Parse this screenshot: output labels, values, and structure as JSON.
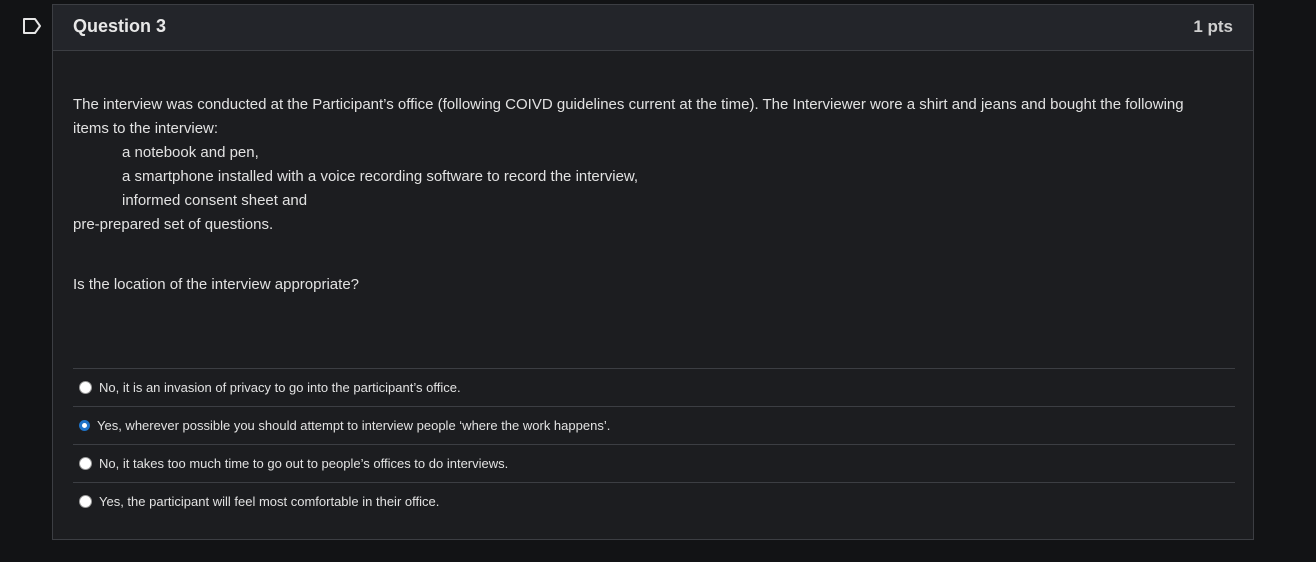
{
  "question": {
    "title": "Question 3",
    "points": "1 pts",
    "flag_icon": "bookmark-flag-icon",
    "intro": "The interview was conducted at the Participant’s office (following  COIVD guidelines current at the time).  The Interviewer wore a shirt and jeans and bought the following items to the interview:",
    "items": [
      "a notebook and pen,",
      "a smartphone installed with a voice recording software to record the interview,",
      "informed consent sheet and"
    ],
    "closing": "pre-prepared set of questions.",
    "prompt": "Is the location of the interview appropriate?"
  },
  "answers": [
    {
      "label": "No, it is an invasion of privacy to go into the participant’s office.",
      "selected": false
    },
    {
      "label": "Yes, wherever possible you should attempt to interview people ‘where the work happens’.",
      "selected": true
    },
    {
      "label": "No, it takes too much time to go out to people’s offices to do interviews.",
      "selected": false
    },
    {
      "label": "Yes, the participant will feel most comfortable in their office.",
      "selected": false
    }
  ],
  "colors": {
    "background": "#121315",
    "panel": "#1c1d20",
    "header": "#23252a",
    "accent": "#1e73c8"
  }
}
